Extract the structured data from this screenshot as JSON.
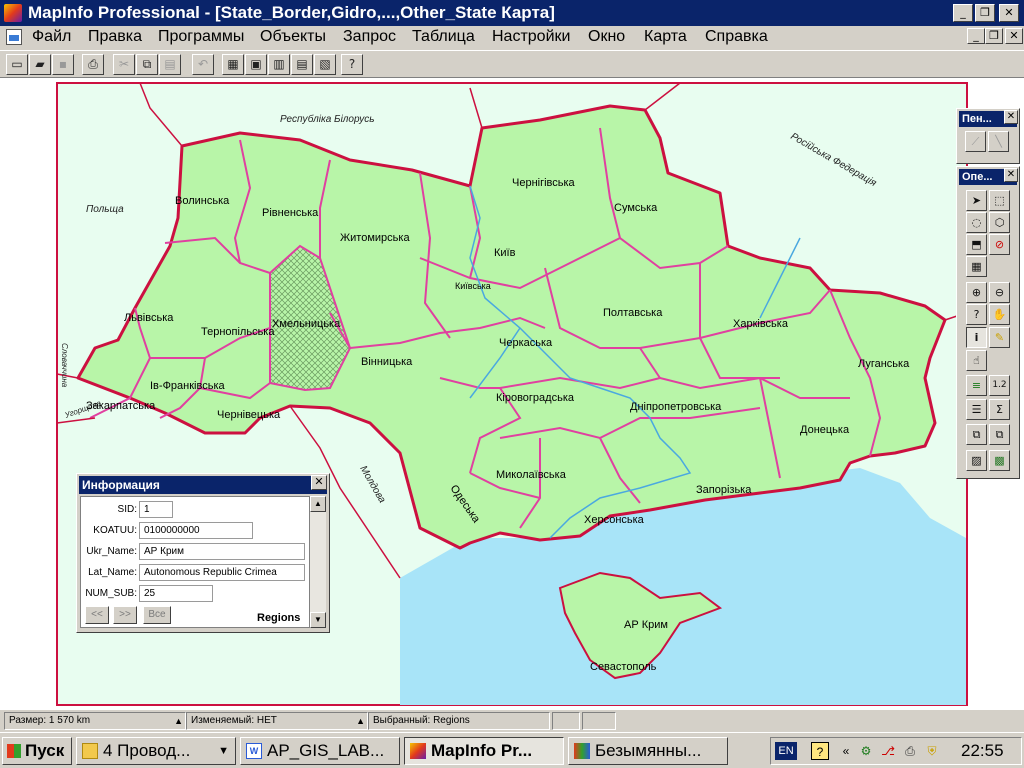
{
  "window": {
    "title": "MapInfo Professional - [State_Border,Gidro,...,Other_State Карта]",
    "min": "_",
    "max": "❐",
    "close": "✕"
  },
  "menu": [
    "Файл",
    "Правка",
    "Программы",
    "Объекты",
    "Запрос",
    "Таблица",
    "Настройки",
    "Окно",
    "Карта",
    "Справка"
  ],
  "map": {
    "countries": [
      "Республіка Білорусь",
      "Польща",
      "Російська Федерація",
      "Молдова",
      "Словаччина",
      "Угорщина"
    ],
    "regions": [
      "Волинська",
      "Рівненська",
      "Житомирська",
      "Чернігівська",
      "Сумська",
      "Київ",
      "Київська",
      "Львівська",
      "Хмельницька",
      "Тернопільська",
      "Вінницька",
      "Черкаська",
      "Полтавська",
      "Харківська",
      "Луганська",
      "Закарпатська",
      "Ів-Франківська",
      "Чернівецька",
      "Кіровоградська",
      "Дніпропетровська",
      "Донецька",
      "Миколаївська",
      "Одеська",
      "Запорізька",
      "Херсонська",
      "АР Крим",
      "Севастополь"
    ],
    "colors": {
      "land": "#b8f5a8",
      "border": "#e040a0",
      "state_border": "#cc1040",
      "sea": "#a8e4f8",
      "river": "#4aa8e0",
      "background": "#e8fdf0"
    }
  },
  "info": {
    "title": "Информация",
    "fields": [
      {
        "label": "SID:",
        "value": "1"
      },
      {
        "label": "KOATUU:",
        "value": "0100000000"
      },
      {
        "label": "Ukr_Name:",
        "value": "АР Крим"
      },
      {
        "label": "Lat_Name:",
        "value": "Autonomous Republic Crimea"
      },
      {
        "label": "NUM_SUB:",
        "value": "25"
      }
    ],
    "nav": [
      "<<",
      ">>",
      "Все"
    ],
    "table": "Regions"
  },
  "palettes": {
    "pen": "Пен...",
    "ops": "Опе..."
  },
  "status": {
    "size": "Размер: 1 570 km",
    "editable": "Изменяемый: НЕТ",
    "selected": "Выбранный: Regions"
  },
  "taskbar": {
    "start": "Пуск",
    "tasks": [
      "4 Провод...",
      "AP_GIS_LAB...",
      "MapInfo Pr...",
      "Безымянны..."
    ],
    "lang": "EN",
    "clock": "22:55"
  }
}
